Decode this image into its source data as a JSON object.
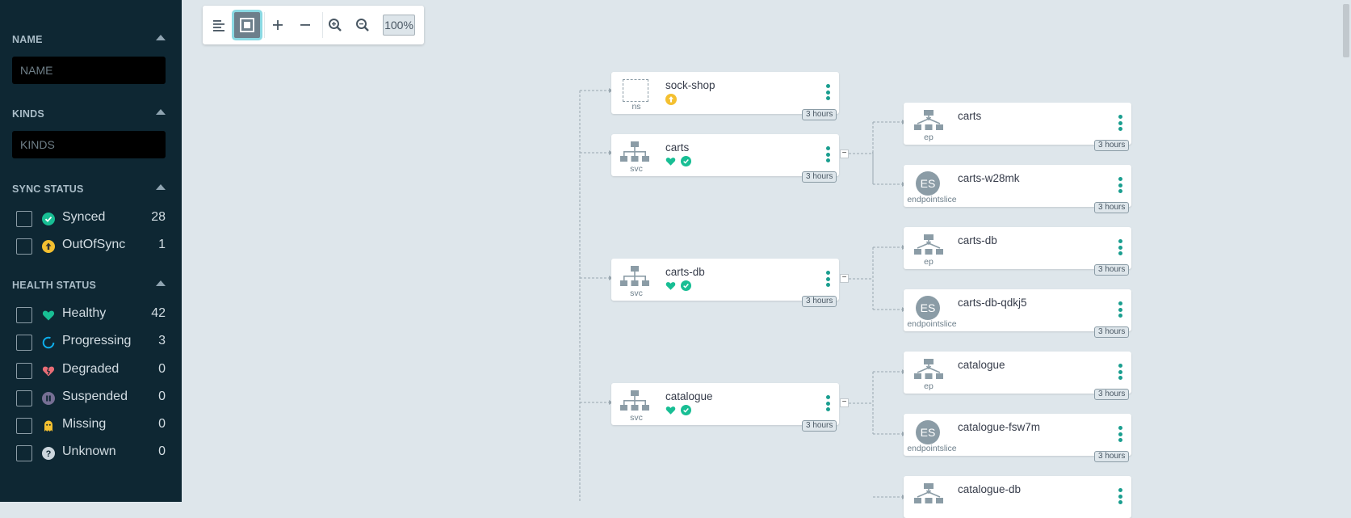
{
  "sidebar": {
    "name": {
      "title": "NAME",
      "placeholder": "NAME"
    },
    "kinds": {
      "title": "KINDS",
      "placeholder": "KINDS"
    },
    "sync_status": {
      "title": "SYNC STATUS",
      "items": [
        {
          "label": "Synced",
          "count": "28",
          "icon": "synced-check-icon",
          "color": "#18be94"
        },
        {
          "label": "OutOfSync",
          "count": "1",
          "icon": "out-of-sync-arrow-icon",
          "color": "#f4c030"
        }
      ]
    },
    "health_status": {
      "title": "HEALTH STATUS",
      "items": [
        {
          "label": "Healthy",
          "count": "42",
          "icon": "heart-icon",
          "color": "#18be94"
        },
        {
          "label": "Progressing",
          "count": "3",
          "icon": "progress-circle-icon",
          "color": "#0dadea"
        },
        {
          "label": "Degraded",
          "count": "0",
          "icon": "broken-heart-icon",
          "color": "#e96d76"
        },
        {
          "label": "Suspended",
          "count": "0",
          "icon": "pause-icon",
          "color": "#766f94"
        },
        {
          "label": "Missing",
          "count": "0",
          "icon": "ghost-icon",
          "color": "#f4c030"
        },
        {
          "label": "Unknown",
          "count": "0",
          "icon": "question-icon",
          "color": "#ccd6dd"
        }
      ]
    }
  },
  "toolbar": {
    "zoom": "100%"
  },
  "nodes": {
    "sock_shop": {
      "name": "sock-shop",
      "kind": "ns",
      "age": "3 hours"
    },
    "carts_svc": {
      "name": "carts",
      "kind": "svc",
      "age": "3 hours"
    },
    "carts_db_svc": {
      "name": "carts-db",
      "kind": "svc",
      "age": "3 hours"
    },
    "catalogue_svc": {
      "name": "catalogue",
      "kind": "svc",
      "age": "3 hours"
    },
    "carts_ep": {
      "name": "carts",
      "kind": "ep",
      "age": "3 hours"
    },
    "carts_es": {
      "name": "carts-w28mk",
      "kind": "endpointslice",
      "badge": "ES",
      "age": "3 hours"
    },
    "carts_db_ep": {
      "name": "carts-db",
      "kind": "ep",
      "age": "3 hours"
    },
    "carts_db_es": {
      "name": "carts-db-qdkj5",
      "kind": "endpointslice",
      "badge": "ES",
      "age": "3 hours"
    },
    "catalogue_ep": {
      "name": "catalogue",
      "kind": "ep",
      "age": "3 hours"
    },
    "catalogue_es": {
      "name": "catalogue-fsw7m",
      "kind": "endpointslice",
      "badge": "ES",
      "age": "3 hours"
    },
    "catalogue_db_ep": {
      "name": "catalogue-db",
      "kind": "ep"
    }
  },
  "colors": {
    "healthy": "#18be94",
    "synced": "#18be94",
    "out_of_sync": "#f4c030",
    "kebab": "#1a9e8f"
  }
}
